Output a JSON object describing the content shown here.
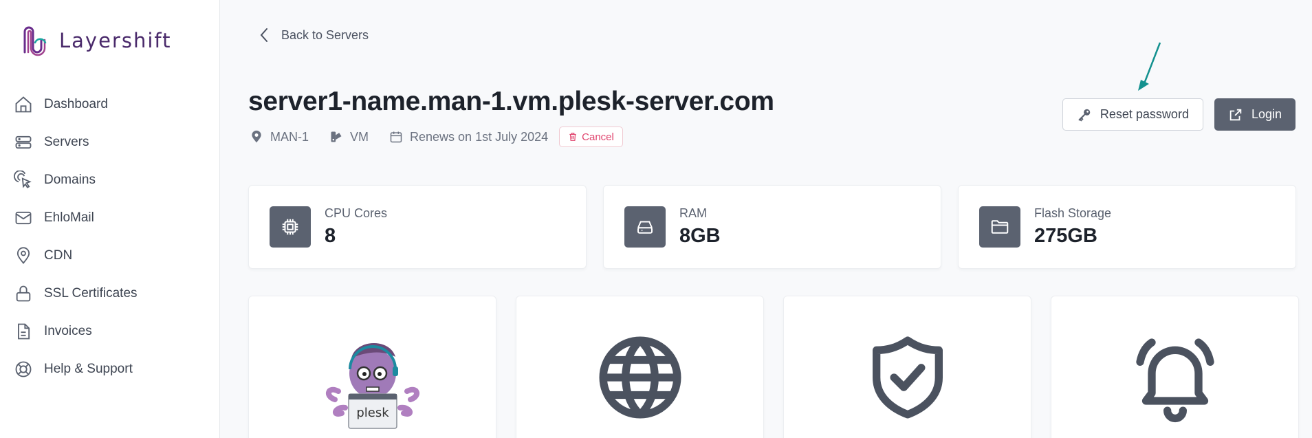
{
  "brand": {
    "name": "Layershift",
    "color": "#4a2a6b"
  },
  "sidebar": {
    "items": [
      {
        "label": "Dashboard",
        "icon": "home-icon"
      },
      {
        "label": "Servers",
        "icon": "server-icon"
      },
      {
        "label": "Domains",
        "icon": "pointer-signal-icon"
      },
      {
        "label": "EhloMail",
        "icon": "mail-icon"
      },
      {
        "label": "CDN",
        "icon": "location-pin-icon"
      },
      {
        "label": "SSL Certificates",
        "icon": "lock-icon"
      },
      {
        "label": "Invoices",
        "icon": "document-icon"
      },
      {
        "label": "Help & Support",
        "icon": "lifebuoy-icon"
      }
    ]
  },
  "header": {
    "back_label": "Back to Servers",
    "title": "server1-name.man-1.vm.plesk-server.com",
    "location": "MAN-1",
    "type": "VM",
    "renewal": "Renews on 1st July 2024",
    "cancel_label": "Cancel"
  },
  "actions": {
    "reset_label": "Reset password",
    "login_label": "Login"
  },
  "stats": [
    {
      "label": "CPU Cores",
      "value": "8",
      "icon": "cpu-icon"
    },
    {
      "label": "RAM",
      "value": "8GB",
      "icon": "hard-drive-icon"
    },
    {
      "label": "Flash Storage",
      "value": "275GB",
      "icon": "folder-icon"
    }
  ],
  "tiles": [
    {
      "icon": "plesk-mascot-logo",
      "logo_text": "plesk"
    },
    {
      "icon": "globe-icon"
    },
    {
      "icon": "shield-check-icon"
    },
    {
      "icon": "bell-icon"
    }
  ],
  "colors": {
    "accent": "#5b6270",
    "danger": "#e0436d",
    "annotation_arrow": "#13918f"
  }
}
